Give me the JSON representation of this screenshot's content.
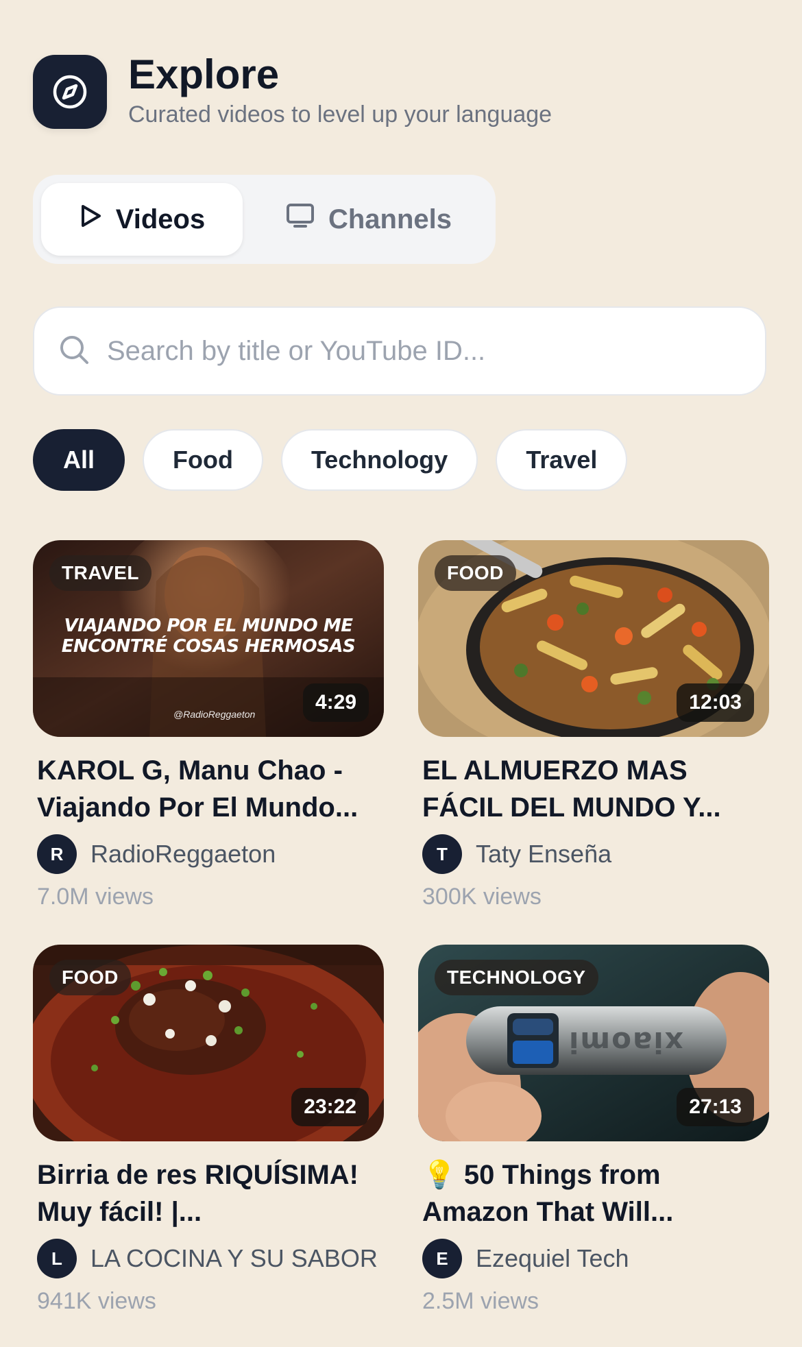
{
  "header": {
    "title": "Explore",
    "subtitle": "Curated videos to level up your language",
    "icon": "compass-icon"
  },
  "tabs": [
    {
      "label": "Videos",
      "icon": "play-icon",
      "active": true
    },
    {
      "label": "Channels",
      "icon": "monitor-icon",
      "active": false
    }
  ],
  "search": {
    "placeholder": "Search by title or YouTube ID...",
    "value": ""
  },
  "filters": [
    {
      "label": "All",
      "active": true
    },
    {
      "label": "Food",
      "active": false
    },
    {
      "label": "Technology",
      "active": false
    },
    {
      "label": "Travel",
      "active": false
    }
  ],
  "videos": [
    {
      "category": "TRAVEL",
      "duration": "4:29",
      "title": "KAROL G, Manu Chao - Viajando Por El Mundo...",
      "channel": "RadioReggaeton",
      "avatar_letter": "R",
      "views": "7.0M views",
      "thumb_caption_1": "VIAJANDO POR EL MUNDO ME",
      "thumb_caption_2": "ENCONTRÉ COSAS HERMOSAS",
      "thumb_watermark": "@RadioReggaeton"
    },
    {
      "category": "FOOD",
      "duration": "12:03",
      "title": "EL ALMUERZO MAS FÁCIL DEL MUNDO Y...",
      "channel": "Taty Enseña",
      "avatar_letter": "T",
      "views": "300K views"
    },
    {
      "category": "FOOD",
      "duration": "23:22",
      "title": "Birria de res RIQUÍSIMA! Muy fácil! |...",
      "channel": "LA COCINA Y SU SABOR",
      "avatar_letter": "L",
      "views": "941K views"
    },
    {
      "category": "TECHNOLOGY",
      "duration": "27:13",
      "title": "💡 50 Things from Amazon That Will...",
      "channel": "Ezequiel Tech",
      "avatar_letter": "E",
      "views": "2.5M views",
      "thumb_logo_text": "xiaomi"
    }
  ],
  "colors": {
    "background": "#f3ebde",
    "accent_dark": "#182033"
  }
}
